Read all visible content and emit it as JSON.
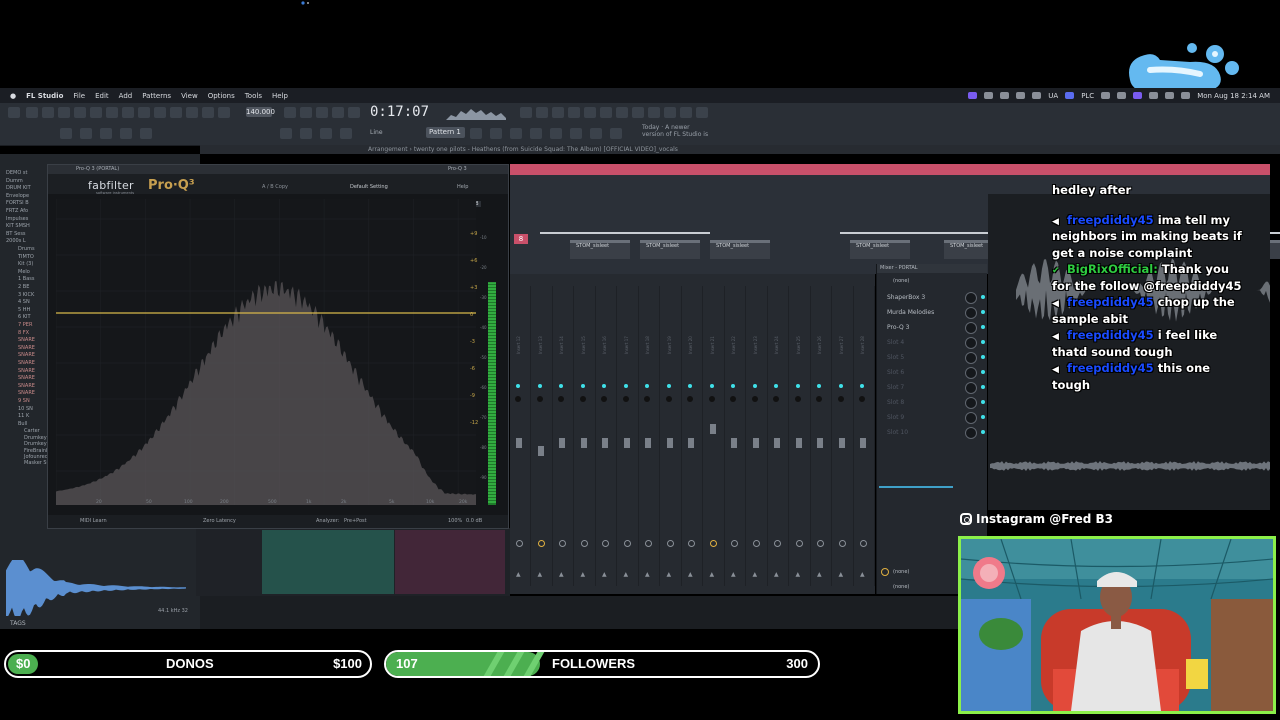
{
  "colors": {
    "accent": "#3fe0e8",
    "goal_fill": "#4caf50",
    "chat_user": "#1a4bff",
    "chat_user_alt": "#2ecc40",
    "webcam_border": "#8cf04a",
    "playlist_header": "#c9506a",
    "proq_brand": "#c8a050"
  },
  "menubar": {
    "apple": "",
    "app": "FL Studio",
    "items": [
      "File",
      "Edit",
      "Add",
      "Patterns",
      "View",
      "Options",
      "Tools",
      "Help"
    ],
    "status": [
      "UA",
      "PLC"
    ],
    "datetime": "Mon Aug 18  2:14 AM"
  },
  "toolbar": {
    "tempo": "140.000",
    "time": "0:17:07",
    "pattern": "Pattern 1",
    "snap": "Line",
    "hint_line1": "Today · A newer",
    "hint_line2": "version of FL Studio is"
  },
  "playlist": {
    "title": "Arrangement  ›  twenty one pilots - Heathens (from Suicide Squad: The Album) [OFFICIAL VIDEO]_vocals",
    "track_badge": "8",
    "clip_label": "STOM_sisleet",
    "clips": [
      "STOM_sisleet",
      "STOM_sisleet",
      "STOM_sisleet",
      "STOM_sisleet",
      "STOM_sisleet",
      "STOM_sisleet"
    ]
  },
  "browser": {
    "items": [
      "DEMO st",
      "Dumm",
      "DRUM KIT",
      "Envelope",
      "FORTSI B",
      "FRTZ Afo",
      "Impulses",
      "KIT SMSH",
      "BT Sess",
      "2000s L",
      "Drums",
      "TIMTO",
      "Kit (3)",
      "Melo",
      "1 Bass",
      "2 BE",
      "3 KICK",
      "4 SN",
      "5 HH",
      "6 KIT",
      "7 PER",
      "8 FX",
      "SNARE",
      "SNARE",
      "SNARE",
      "SNARE",
      "SNARE",
      "SNARE",
      "SNARE",
      "SNARE",
      "9 SN",
      "10 SN",
      "11 K",
      "Bull",
      "Carter",
      "Drumkey 8",
      "Drumkey 808 Lit Mbrt",
      "FireBrainblock (Shows the Screen) Drumkit",
      "Jofounrede (Shows the Screen) Drumkit",
      "Masker Studio Sounds"
    ],
    "sample_info": "44.1 kHz 32",
    "tags": "TAGS"
  },
  "proq": {
    "window_title": "Pro-Q 3 (PORTAL)",
    "tab_title": "Pro-Q 3",
    "brand": "fabfilter",
    "brand_sub": "software instruments",
    "product": "Pro·Q³",
    "ab": "A / B  Copy",
    "preset": "Default Setting",
    "help": "Help",
    "db_range": "12 dB",
    "db_labels": [
      "+9",
      "+6",
      "+3",
      "0",
      "-3",
      "-6",
      "-9",
      "-12"
    ],
    "meter_labels": [
      "-10",
      "-20",
      "-30",
      "-40",
      "-50",
      "-60",
      "-70",
      "-80",
      "-90"
    ],
    "freq_labels": [
      "20",
      "50",
      "100",
      "200",
      "500",
      "1k",
      "2k",
      "5k",
      "10k",
      "20k"
    ],
    "midi_learn": "MIDI Learn",
    "latency": "Zero Latency",
    "analyzer": "Analyzer:",
    "analyzer_val": "Pre+Post",
    "zoom": "100%",
    "gain": "0.0 dB"
  },
  "mixer": {
    "title": "Mixer - PORTAL",
    "none_label": "(none)",
    "slots": [
      {
        "label": "ShaperBox 3",
        "active": true
      },
      {
        "label": "Murda Melodies",
        "active": true
      },
      {
        "label": "Pro-Q 3",
        "active": true
      },
      {
        "label": "Slot 4",
        "active": false
      },
      {
        "label": "Slot 5",
        "active": false
      },
      {
        "label": "Slot 6",
        "active": false
      },
      {
        "label": "Slot 7",
        "active": false
      },
      {
        "label": "Slot 8",
        "active": false
      },
      {
        "label": "Slot 9",
        "active": false
      },
      {
        "label": "Slot 10",
        "active": false
      }
    ],
    "out1": "(none)",
    "out2": "(none)",
    "insert_labels": [
      "Insert 12",
      "Insert 13",
      "Insert 14",
      "Insert 15",
      "Insert 16",
      "Insert 17",
      "Insert 18",
      "Insert 19",
      "Insert 20",
      "Insert 21",
      "Insert 22",
      "Insert 23",
      "Insert 24",
      "Insert 25",
      "Insert 26",
      "Insert 27",
      "Insert 28"
    ]
  },
  "chat": {
    "lines": [
      {
        "user": "",
        "text": "hedley after",
        "icon": ""
      },
      {
        "user": "freepdiddy45",
        "text": "ima tell my",
        "icon": "speaker-icon"
      },
      {
        "user": "",
        "text": "neighbors im making beats if",
        "icon": ""
      },
      {
        "user": "",
        "text": "get a noise complaint",
        "icon": ""
      },
      {
        "user": "BigRixOfficial:",
        "text": "Thank you",
        "icon": "check-icon"
      },
      {
        "user": "",
        "text": "for the follow @freepdiddy45",
        "icon": ""
      },
      {
        "user": "freepdiddy45",
        "text": "chop up the",
        "icon": "speaker-icon"
      },
      {
        "user": "",
        "text": "sample abit",
        "icon": ""
      },
      {
        "user": "freepdiddy45",
        "text": "i feel like",
        "icon": "speaker-icon"
      },
      {
        "user": "",
        "text": "thatd sound tough",
        "icon": ""
      },
      {
        "user": "freepdiddy45",
        "text": "this one",
        "icon": "speaker-icon"
      },
      {
        "user": "",
        "text": "tough",
        "icon": ""
      }
    ]
  },
  "instagram": "Instagram @Fred B3",
  "donos": {
    "current": "$0",
    "label": "DONOS",
    "goal": "$100",
    "progress": 0
  },
  "followers": {
    "current": "107",
    "label": "FOLLOWERS",
    "goal": "300",
    "progress": 0.357
  }
}
